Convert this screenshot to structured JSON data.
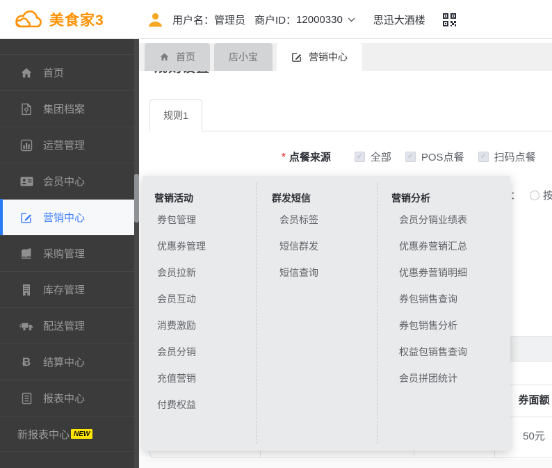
{
  "topbar": {
    "logo_text": "美食家3",
    "username_label": "用户名：",
    "username": "管理员",
    "merchant_label": "商户ID：",
    "merchant_id": "12000330",
    "store_name": "思迅大酒楼"
  },
  "sidebar": {
    "items": [
      {
        "label": "首页",
        "icon": "home-icon"
      },
      {
        "label": "集团档案",
        "icon": "archive-icon"
      },
      {
        "label": "运营管理",
        "icon": "chart-icon"
      },
      {
        "label": "会员中心",
        "icon": "members-icon"
      },
      {
        "label": "营销中心",
        "icon": "marketing-edit-icon",
        "active": true
      },
      {
        "label": "采购管理",
        "icon": "purchase-book-icon"
      },
      {
        "label": "库存管理",
        "icon": "inventory-building-icon"
      },
      {
        "label": "配送管理",
        "icon": "delivery-truck-icon"
      },
      {
        "label": "结算中心",
        "icon": "settlement-bitcoin-icon"
      },
      {
        "label": "报表中心",
        "icon": "report-file-icon"
      },
      {
        "label": "新报表中心",
        "badge": "NEW"
      }
    ]
  },
  "tabs": [
    {
      "label": "首页",
      "icon": "home-icon"
    },
    {
      "label": "店小宝"
    },
    {
      "label": "营销中心",
      "icon": "edit-icon",
      "active": true
    }
  ],
  "content": {
    "clipped_heading": "规则设置",
    "rule_tab_label": "规则1",
    "form": {
      "required_mark": "*",
      "label": "点餐来源",
      "checkboxes": [
        {
          "label": "全部",
          "checked": true,
          "disabled": true
        },
        {
          "label": "POS点餐",
          "checked": true,
          "disabled": true
        },
        {
          "label": "扫码点餐",
          "checked": true,
          "disabled": true
        }
      ],
      "check_glyph": "✓"
    },
    "radio_fragment": {
      "colon": "：",
      "label": "按"
    },
    "table_fragment": {
      "header": "券面额",
      "value": "50元"
    }
  },
  "megamenu": {
    "columns": [
      {
        "title": "营销活动",
        "items": [
          "券包管理",
          "优惠券管理",
          "会员拉新",
          "会员互动",
          "消费激励",
          "会员分销",
          "充值营销",
          "付费权益"
        ]
      },
      {
        "title": "群发短信",
        "items": [
          "会员标签",
          "短信群发",
          "短信查询"
        ]
      },
      {
        "title": "营销分析",
        "items": [
          "会员分销业绩表",
          "优惠券营销汇总",
          "优惠券营销明细",
          "券包销售查询",
          "券包销售分析",
          "权益包销售查询",
          "会员拼团统计"
        ]
      }
    ]
  },
  "icons": {
    "bitcoin_glyph": "Ƀ"
  },
  "colors": {
    "brand_orange": "#ff9102",
    "sidebar_bg": "#3b3b3b",
    "active_blue": "#3d7eff",
    "badge_yellow": "#ffe400",
    "menu_bg": "#e9eaec"
  }
}
